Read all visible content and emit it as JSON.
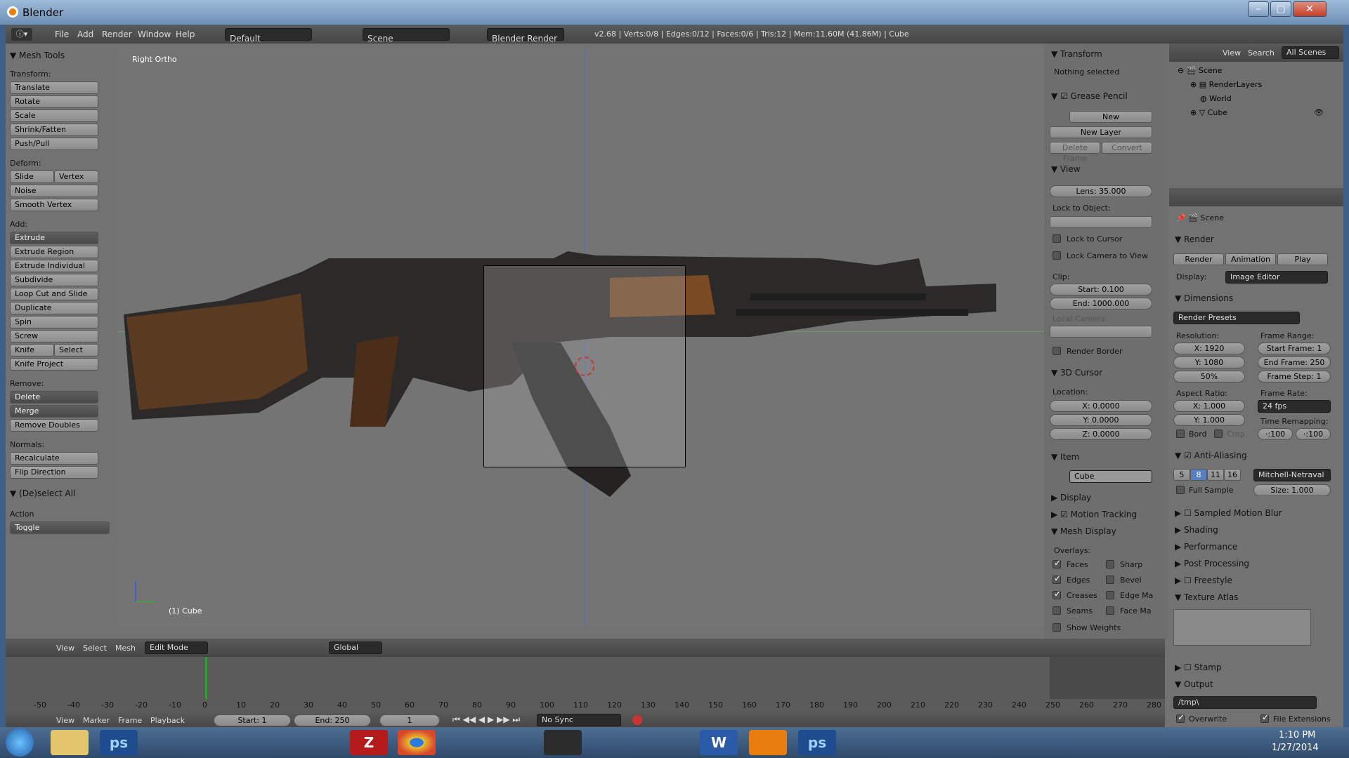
{
  "window": {
    "title": "Blender"
  },
  "menu": {
    "file": "File",
    "add": "Add",
    "render": "Render",
    "window": "Window",
    "help": "Help",
    "layout": "Default",
    "scene": "Scene",
    "engine": "Blender Render",
    "stats": "v2.68 | Verts:0/8 | Edges:0/12 | Faces:0/6 | Tris:12 | Mem:11.60M (41.86M) | Cube"
  },
  "toolshelf": {
    "title": "Mesh Tools",
    "transform_label": "Transform:",
    "transform": [
      "Translate",
      "Rotate",
      "Scale",
      "Shrink/Fatten",
      "Push/Pull"
    ],
    "deform_label": "Deform:",
    "slide_edge": "Slide Edge",
    "vertex": "Vertex",
    "noise": "Noise",
    "smooth_vertex": "Smooth Vertex",
    "add_label": "Add:",
    "extrude": "Extrude",
    "add": [
      "Extrude Region",
      "Extrude Individual",
      "Subdivide",
      "Loop Cut and Slide",
      "Duplicate",
      "Spin",
      "Screw"
    ],
    "knife": "Knife",
    "select": "Select",
    "knife_project": "Knife Project",
    "remove_label": "Remove:",
    "delete": "Delete",
    "merge": "Merge",
    "remove_doubles": "Remove Doubles",
    "normals_label": "Normals:",
    "recalculate": "Recalculate",
    "flip_direction": "Flip Direction",
    "deselect_all": "(De)select All",
    "action": "Action",
    "toggle": "Toggle"
  },
  "viewport": {
    "label": "Right Ortho",
    "object": "(1) Cube"
  },
  "npanel": {
    "transform": "Transform",
    "nothing_selected": "Nothing selected",
    "grease_pencil": "Grease Pencil",
    "new": "New",
    "new_layer": "New Layer",
    "delete_frame": "Delete Frame",
    "convert": "Convert",
    "view": "View",
    "lens": "Lens: 35.000",
    "lock_to_object": "Lock to Object:",
    "lock_to_cursor": "Lock to Cursor",
    "lock_camera": "Lock Camera to View",
    "clip": "Clip:",
    "clip_start": "Start: 0.100",
    "clip_end": "End: 1000.000",
    "local_camera": "Local Camera:",
    "render_border": "Render Border",
    "cursor": "3D Cursor",
    "location": "Location:",
    "cx": "X: 0.0000",
    "cy": "Y: 0.0000",
    "cz": "Z: 0.0000",
    "item": "Item",
    "item_name": "Cube",
    "display": "Display",
    "motion_tracking": "Motion Tracking",
    "mesh_display": "Mesh Display",
    "overlays": "Overlays:",
    "faces": "Faces",
    "sharp": "Sharp",
    "edges": "Edges",
    "bevel": "Bevel",
    "creases": "Creases",
    "edge_ma": "Edge Ma",
    "seams": "Seams",
    "face_ma": "Face Ma",
    "show_weights": "Show Weights"
  },
  "outliner": {
    "view": "View",
    "search": "Search",
    "all_scenes": "All Scenes",
    "scene": "Scene",
    "renderlayers": "RenderLayers",
    "world": "World",
    "cube": "Cube"
  },
  "props": {
    "scene": "Scene",
    "render": "Render",
    "render_btn": "Render",
    "animation_btn": "Animation",
    "play_btn": "Play",
    "display": "Display:",
    "display_val": "Image Editor",
    "dimensions": "Dimensions",
    "presets": "Render Presets",
    "resolution": "Resolution:",
    "rx": "X: 1920",
    "ry": "Y: 1080",
    "rpct": "50%",
    "frame_range": "Frame Range:",
    "start_frame": "Start Frame: 1",
    "end_frame": "End Frame: 250",
    "frame_step": "Frame Step: 1",
    "aspect": "Aspect Ratio:",
    "ax": "X: 1.000",
    "ay": "Y: 1.000",
    "frame_rate": "Frame Rate:",
    "fps": "24 fps",
    "time_remap": "Time Remapping:",
    "bord": "Bord",
    "crop": "Crop",
    "remap_old": "·:100",
    "remap_new": "·:100",
    "anti_aliasing": "Anti-Aliasing",
    "aa5": "5",
    "aa8": "8",
    "aa11": "11",
    "aa16": "16",
    "filter": "Mitchell-Netraval",
    "full_sample": "Full Sample",
    "size": "Size: 1.000",
    "motion_blur": "Sampled Motion Blur",
    "shading": "Shading",
    "performance": "Performance",
    "post_processing": "Post Processing",
    "freestyle": "Freestyle",
    "texture_atlas": "Texture Atlas",
    "stamp": "Stamp",
    "output": "Output",
    "path": "/tmp\\",
    "overwrite": "Overwrite",
    "file_ext": "File Extensions"
  },
  "viewheader": {
    "view": "View",
    "select": "Select",
    "mesh": "Mesh",
    "mode": "Edit Mode",
    "orientation": "Global"
  },
  "timeline": {
    "ticks": [
      "-50",
      "-40",
      "-30",
      "-20",
      "-10",
      "0",
      "10",
      "20",
      "30",
      "40",
      "50",
      "60",
      "70",
      "80",
      "90",
      "100",
      "110",
      "120",
      "130",
      "140",
      "150",
      "160",
      "170",
      "180",
      "190",
      "200",
      "210",
      "220",
      "230",
      "240",
      "250",
      "260",
      "270",
      "280"
    ],
    "view": "View",
    "marker": "Marker",
    "frame": "Frame",
    "playback": "Playback",
    "start": "Start: 1",
    "end": "End: 250",
    "current": "1",
    "sync": "No Sync"
  },
  "taskbar": {
    "time": "1:10 PM",
    "date": "1/27/2014"
  }
}
